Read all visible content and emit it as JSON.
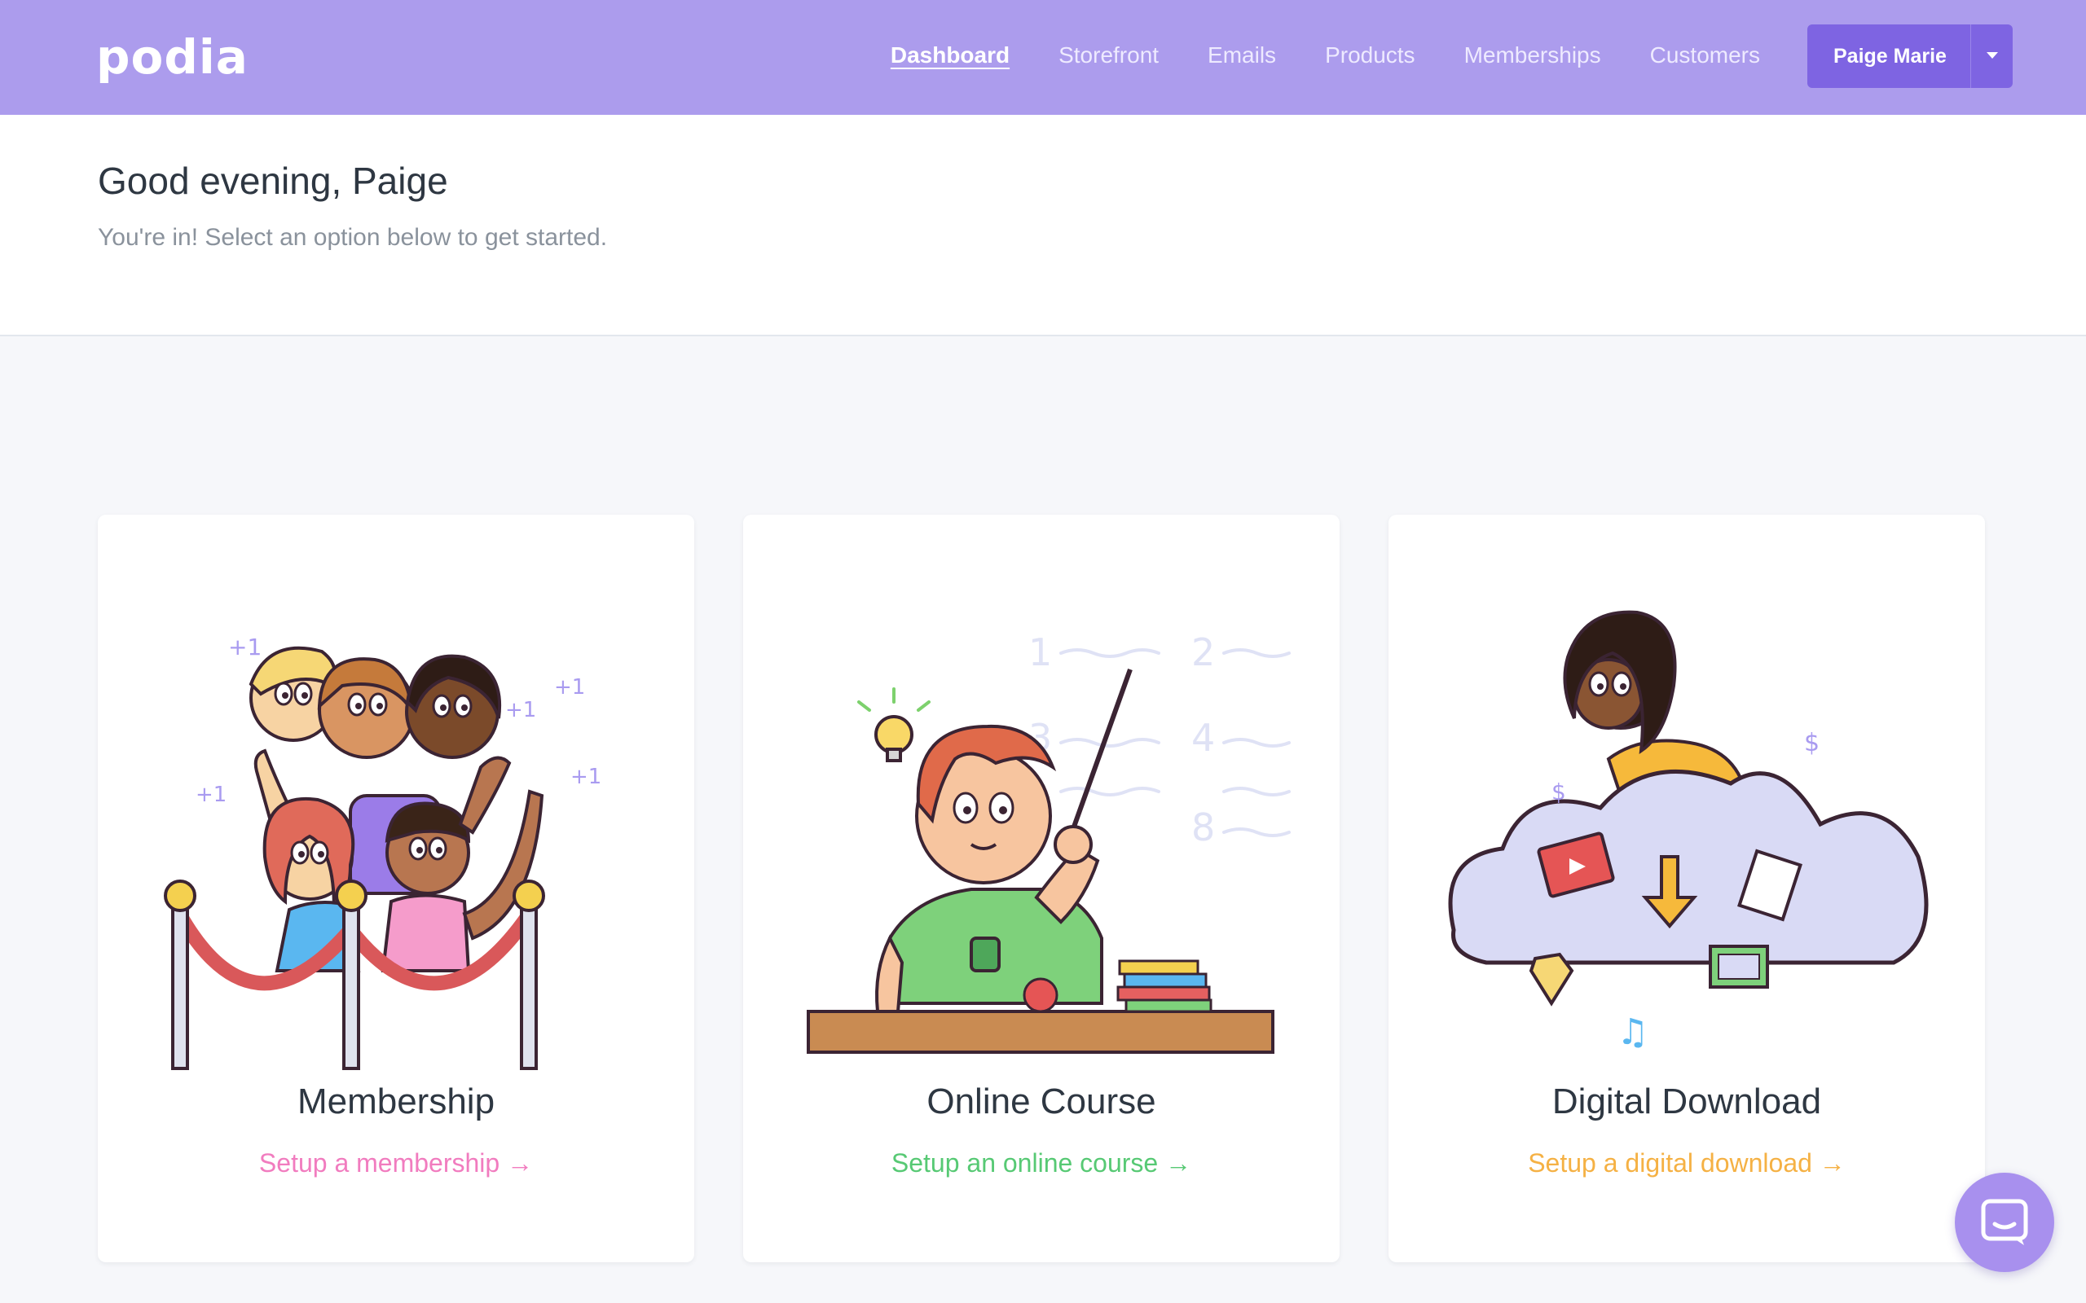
{
  "app": {
    "logo_text": "podia",
    "brand_color": "#ac9ced",
    "accent_color": "#7e64e2"
  },
  "nav": {
    "items": [
      {
        "label": "Dashboard",
        "active": true
      },
      {
        "label": "Storefront",
        "active": false
      },
      {
        "label": "Emails",
        "active": false
      },
      {
        "label": "Products",
        "active": false
      },
      {
        "label": "Memberships",
        "active": false
      },
      {
        "label": "Customers",
        "active": false
      }
    ],
    "user": {
      "name": "Paige Marie",
      "icon": "chevron-down-icon"
    }
  },
  "header": {
    "greeting": "Good evening, Paige",
    "subtext": "You're in! Select an option below to get started."
  },
  "cards": [
    {
      "title": "Membership",
      "link": "Setup a membership →",
      "link_color": "#f17cbf",
      "illustration": "membership-crowd-illustration"
    },
    {
      "title": "Online Course",
      "link": "Setup an online course →",
      "link_color": "#57c974",
      "illustration": "teacher-chalkboard-illustration"
    },
    {
      "title": "Digital Download",
      "link": "Setup a digital download →",
      "link_color": "#f5b144",
      "illustration": "cloud-download-illustration"
    }
  ],
  "chat": {
    "icon": "chat-icon"
  }
}
